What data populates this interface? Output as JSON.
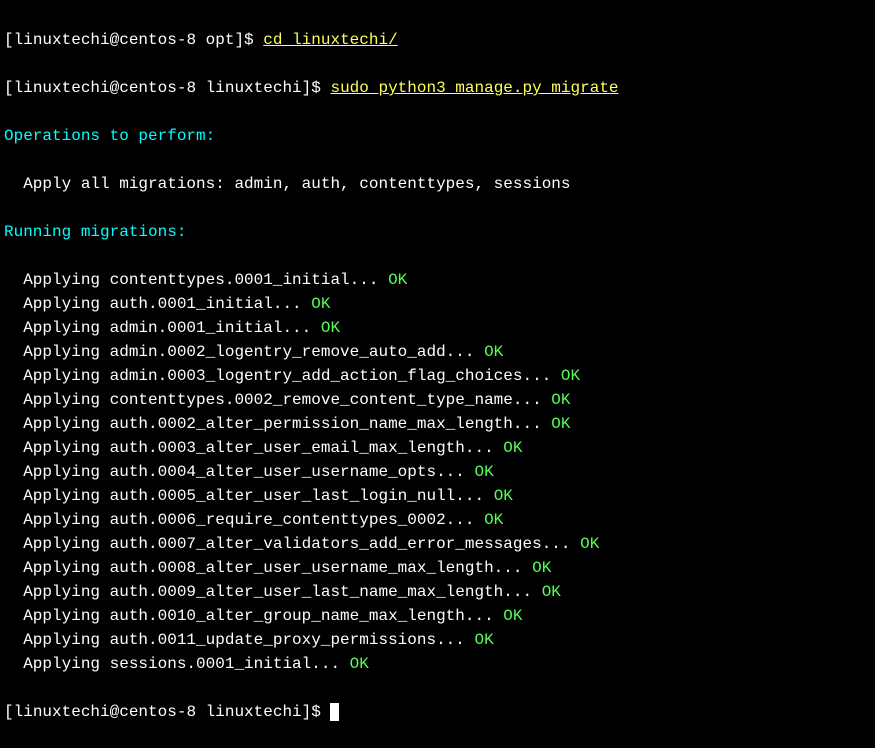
{
  "prompt1": {
    "open": "[",
    "userhost": "linuxtechi@centos-8 opt",
    "close": "]$ ",
    "command": "cd linuxtechi/"
  },
  "prompt2": {
    "open": "[",
    "userhost": "linuxtechi@centos-8 linuxtechi",
    "close": "]$ ",
    "command": "sudo python3 manage.py migrate"
  },
  "header1": "Operations to perform:",
  "apply_all": "  Apply all migrations: admin, auth, contenttypes, sessions",
  "header2": "Running migrations:",
  "migrations": [
    {
      "prefix": "  Applying contenttypes.0001_initial... ",
      "status": "OK"
    },
    {
      "prefix": "  Applying auth.0001_initial... ",
      "status": "OK"
    },
    {
      "prefix": "  Applying admin.0001_initial... ",
      "status": "OK"
    },
    {
      "prefix": "  Applying admin.0002_logentry_remove_auto_add... ",
      "status": "OK"
    },
    {
      "prefix": "  Applying admin.0003_logentry_add_action_flag_choices... ",
      "status": "OK"
    },
    {
      "prefix": "  Applying contenttypes.0002_remove_content_type_name... ",
      "status": "OK"
    },
    {
      "prefix": "  Applying auth.0002_alter_permission_name_max_length... ",
      "status": "OK"
    },
    {
      "prefix": "  Applying auth.0003_alter_user_email_max_length... ",
      "status": "OK"
    },
    {
      "prefix": "  Applying auth.0004_alter_user_username_opts... ",
      "status": "OK"
    },
    {
      "prefix": "  Applying auth.0005_alter_user_last_login_null... ",
      "status": "OK"
    },
    {
      "prefix": "  Applying auth.0006_require_contenttypes_0002... ",
      "status": "OK"
    },
    {
      "prefix": "  Applying auth.0007_alter_validators_add_error_messages... ",
      "status": "OK"
    },
    {
      "prefix": "  Applying auth.0008_alter_user_username_max_length... ",
      "status": "OK"
    },
    {
      "prefix": "  Applying auth.0009_alter_user_last_name_max_length... ",
      "status": "OK"
    },
    {
      "prefix": "  Applying auth.0010_alter_group_name_max_length... ",
      "status": "OK"
    },
    {
      "prefix": "  Applying auth.0011_update_proxy_permissions... ",
      "status": "OK"
    },
    {
      "prefix": "  Applying sessions.0001_initial... ",
      "status": "OK"
    }
  ],
  "prompt3": {
    "open": "[",
    "userhost": "linuxtechi@centos-8 linuxtechi",
    "close": "]$ "
  }
}
